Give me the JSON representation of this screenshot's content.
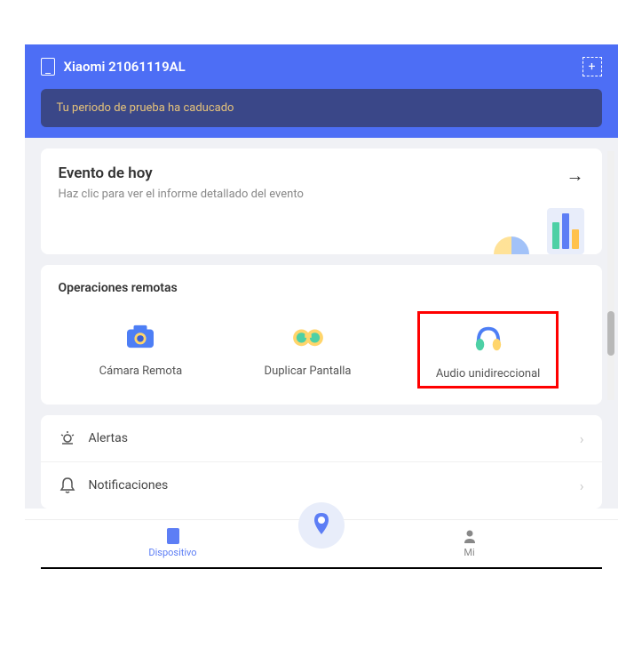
{
  "header": {
    "device_name": "Xiaomi 21061119AL"
  },
  "trial_banner": {
    "text": "Tu periodo de prueba ha caducado"
  },
  "event_card": {
    "title": "Evento de hoy",
    "subtitle": "Haz clic para ver el informe detallado del evento"
  },
  "remote_ops": {
    "title": "Operaciones remotas",
    "items": [
      {
        "label": "Cámara Remota",
        "icon": "camera"
      },
      {
        "label": "Duplicar Pantalla",
        "icon": "binoculars"
      },
      {
        "label": "Audio unidireccional",
        "icon": "headphones"
      }
    ]
  },
  "menu": {
    "items": [
      {
        "label": "Alertas",
        "icon": "alert"
      },
      {
        "label": "Notificaciones",
        "icon": "bell"
      }
    ]
  },
  "bottom_nav": {
    "device_label": "Dispositivo",
    "profile_label": "Mi"
  }
}
